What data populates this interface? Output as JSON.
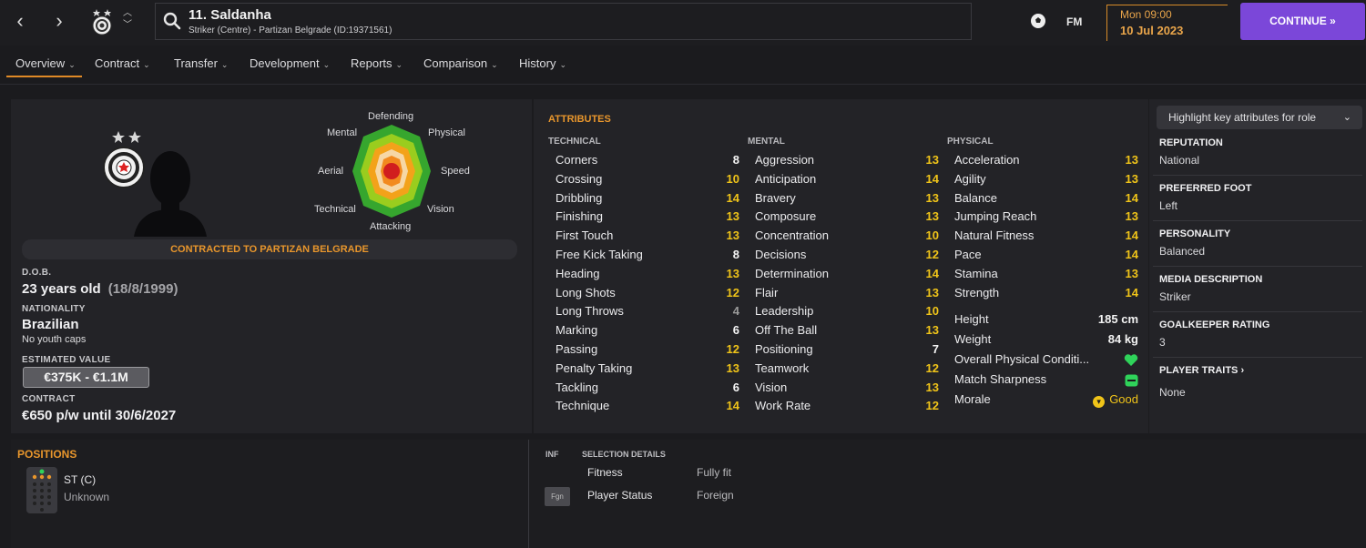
{
  "header": {
    "player_name": "11. Saldanha",
    "player_sub": "Striker (Centre) - Partizan Belgrade (ID:19371561)",
    "fm_label": "FM",
    "date_day": "Mon 09:00",
    "date_date": "10 Jul 2023",
    "continue_label": "CONTINUE"
  },
  "tabs": [
    "Overview",
    "Contract",
    "Transfer",
    "Development",
    "Reports",
    "Comparison",
    "History"
  ],
  "radar": {
    "labels": {
      "top": "Defending",
      "top_left": "Mental",
      "top_right": "Physical",
      "left": "Aerial",
      "right": "Speed",
      "bottom_left": "Technical",
      "bottom_right": "Vision",
      "bottom": "Attacking"
    }
  },
  "profile": {
    "contracted": "CONTRACTED TO PARTIZAN BELGRADE",
    "dob_label": "D.O.B.",
    "dob_age": "23 years old",
    "dob_date": "(18/8/1999)",
    "nationality_label": "NATIONALITY",
    "nationality": "Brazilian",
    "youth_caps": "No youth caps",
    "value_label": "ESTIMATED VALUE",
    "value": "€375K - €1.1M",
    "contract_label": "CONTRACT",
    "contract": "€650 p/w until 30/6/2027"
  },
  "attributes": {
    "title": "ATTRIBUTES",
    "technical_header": "TECHNICAL",
    "mental_header": "MENTAL",
    "physical_header": "PHYSICAL",
    "technical": [
      {
        "name": "Corners",
        "value": "8"
      },
      {
        "name": "Crossing",
        "value": "10"
      },
      {
        "name": "Dribbling",
        "value": "14"
      },
      {
        "name": "Finishing",
        "value": "13"
      },
      {
        "name": "First Touch",
        "value": "13"
      },
      {
        "name": "Free Kick Taking",
        "value": "8"
      },
      {
        "name": "Heading",
        "value": "13"
      },
      {
        "name": "Long Shots",
        "value": "12"
      },
      {
        "name": "Long Throws",
        "value": "4"
      },
      {
        "name": "Marking",
        "value": "6"
      },
      {
        "name": "Passing",
        "value": "12"
      },
      {
        "name": "Penalty Taking",
        "value": "13"
      },
      {
        "name": "Tackling",
        "value": "6"
      },
      {
        "name": "Technique",
        "value": "14"
      }
    ],
    "mental": [
      {
        "name": "Aggression",
        "value": "13"
      },
      {
        "name": "Anticipation",
        "value": "14"
      },
      {
        "name": "Bravery",
        "value": "13"
      },
      {
        "name": "Composure",
        "value": "13"
      },
      {
        "name": "Concentration",
        "value": "10"
      },
      {
        "name": "Decisions",
        "value": "12"
      },
      {
        "name": "Determination",
        "value": "14"
      },
      {
        "name": "Flair",
        "value": "13"
      },
      {
        "name": "Leadership",
        "value": "10"
      },
      {
        "name": "Off The Ball",
        "value": "13"
      },
      {
        "name": "Positioning",
        "value": "7"
      },
      {
        "name": "Teamwork",
        "value": "12"
      },
      {
        "name": "Vision",
        "value": "13"
      },
      {
        "name": "Work Rate",
        "value": "12"
      }
    ],
    "physical": [
      {
        "name": "Acceleration",
        "value": "13"
      },
      {
        "name": "Agility",
        "value": "13"
      },
      {
        "name": "Balance",
        "value": "14"
      },
      {
        "name": "Jumping Reach",
        "value": "13"
      },
      {
        "name": "Natural Fitness",
        "value": "14"
      },
      {
        "name": "Pace",
        "value": "14"
      },
      {
        "name": "Stamina",
        "value": "13"
      },
      {
        "name": "Strength",
        "value": "14"
      }
    ],
    "height_label": "Height",
    "height": "185 cm",
    "weight_label": "Weight",
    "weight": "84 kg",
    "condition_label": "Overall Physical Conditi...",
    "sharpness_label": "Match Sharpness",
    "morale_label": "Morale",
    "morale": "Good"
  },
  "right": {
    "highlight_label": "Highlight key attributes for role",
    "reputation_label": "REPUTATION",
    "reputation": "National",
    "foot_label": "PREFERRED FOOT",
    "foot": "Left",
    "personality_label": "PERSONALITY",
    "personality": "Balanced",
    "media_label": "MEDIA DESCRIPTION",
    "media": "Striker",
    "gk_label": "GOALKEEPER RATING",
    "gk": "3",
    "traits_label": "PLAYER TRAITS",
    "traits": "None"
  },
  "bottom": {
    "positions_title": "POSITIONS",
    "position": "ST (C)",
    "position_sub": "Unknown",
    "inf_label": "INF",
    "selection_label": "SELECTION DETAILS",
    "fitness_label": "Fitness",
    "fitness": "Fully fit",
    "status_label": "Player Status",
    "status": "Foreign",
    "fgn_badge": "Fgn"
  },
  "colors": {
    "accent": "#e8962c",
    "continue": "#7b47d9",
    "attr_value": "#f0c419"
  }
}
